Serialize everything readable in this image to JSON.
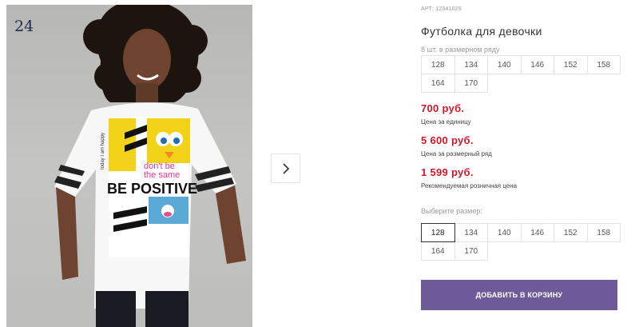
{
  "gallery": {
    "counter": "24",
    "next_icon": "chevron-right-icon",
    "shirt_print": {
      "line1": "don't be",
      "line2": "the same",
      "line3": "BE POSITIVE",
      "side_text": "today I am happy"
    }
  },
  "product": {
    "sku": "АРТ: 12341029",
    "title": "Футболка для девочки"
  },
  "size_row": {
    "label": "8 шт. в размерном ряду",
    "sizes": [
      "128",
      "134",
      "140",
      "146",
      "152",
      "158",
      "164",
      "170"
    ]
  },
  "prices": {
    "unit": {
      "value": "700 руб.",
      "note": "Цена за единицу"
    },
    "row": {
      "value": "5 600 руб.",
      "note": "Цена за размерный ряд"
    },
    "retail": {
      "value": "1 599 руб.",
      "note": "Рекомендуемая розничная цена"
    }
  },
  "size_select": {
    "label": "Выберите размер:",
    "sizes": [
      "128",
      "134",
      "140",
      "146",
      "152",
      "158",
      "164",
      "170"
    ],
    "selected": "128"
  },
  "cart": {
    "button_label": "ДОБАВИТЬ В КОРЗИНУ"
  },
  "colors": {
    "accent": "#6f5a99",
    "price": "#d0182b"
  }
}
